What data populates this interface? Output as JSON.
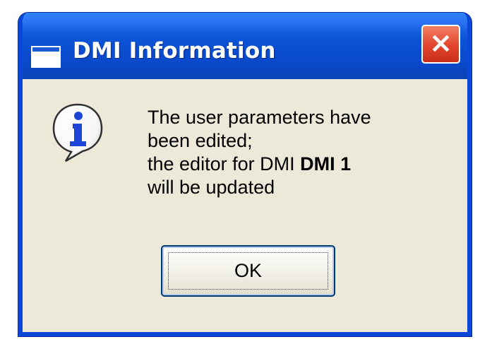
{
  "window": {
    "title": "DMI Information"
  },
  "message": {
    "line_1": "The user parameters have",
    "line_2": "been edited;",
    "line_3_prefix": "the editor for DMI ",
    "line_3_bold": "DMI 1",
    "line_4": "will be updated"
  },
  "buttons": {
    "ok_label": "OK",
    "close_label": "×"
  },
  "icons": {
    "title_app": "window-app-icon",
    "close": "close-icon",
    "info": "information-icon"
  },
  "colors": {
    "titlebar_blue": "#0a47d8",
    "dialog_background": "#ece9d8",
    "close_red": "#e2452e",
    "info_blue": "#1d45d8"
  }
}
